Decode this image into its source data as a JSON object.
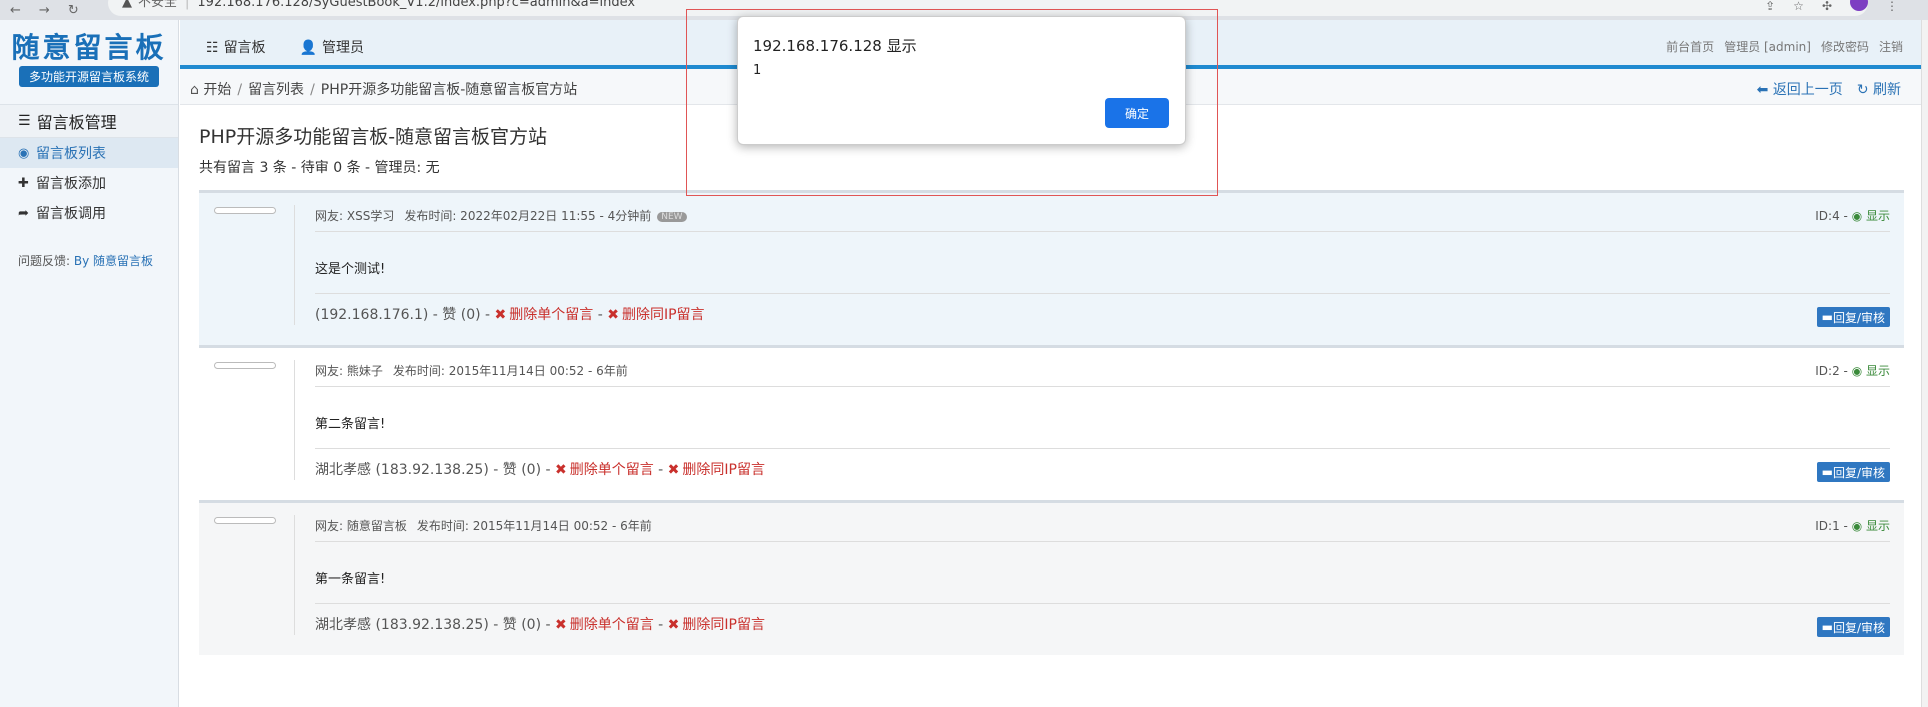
{
  "browser": {
    "insecure_label": "不安全",
    "url": "192.168.176.128/SyGuestBook_V1.2/index.php?c=admin&a=index"
  },
  "sidebar": {
    "logo_title": "随意留言板",
    "logo_sub": "多功能开源留言板系统",
    "section_title": "留言板管理",
    "items": [
      {
        "label": "留言板列表",
        "icon": "globe-icon",
        "active": true
      },
      {
        "label": "留言板添加",
        "icon": "plus-icon",
        "active": false
      },
      {
        "label": "留言板调用",
        "icon": "share-icon",
        "active": false
      }
    ],
    "feedback_label": "问题反馈:",
    "feedback_link": "By 随意留言板"
  },
  "topnav": {
    "tab_guestbook": "留言板",
    "tab_admin": "管理员",
    "link_front": "前台首页",
    "link_admin": "管理员 [admin]",
    "link_password": "修改密码",
    "link_logout": "注销"
  },
  "breadcrumb": {
    "home": "开始",
    "list": "留言列表",
    "site": "PHP开源多功能留言板-随意留言板官方站",
    "back": "返回上一页",
    "refresh": "刷新"
  },
  "main": {
    "title": "PHP开源多功能留言板-随意留言板官方站",
    "summary": "共有留言 3 条 - 待审 0 条 - 管理员: 无"
  },
  "messages": [
    {
      "meta": "网友: XSS学习",
      "time": "发布时间: 2022年02月22日 11:55 - 4分钟前",
      "badge": "NEW",
      "id": "ID:4 - ",
      "show": "显示",
      "content": "这是个测试!",
      "location": "(192.168.176.1) - 赞 (0) - ",
      "delete_one": "删除单个留言",
      "dash": " - ",
      "delete_ip": "删除同IP留言",
      "reply": "回复/审核"
    },
    {
      "meta": "网友: 熊妹子",
      "time": "发布时间: 2015年11月14日 00:52 - 6年前",
      "badge": "",
      "id": "ID:2 - ",
      "show": "显示",
      "content": "第二条留言!",
      "location": "湖北孝感 (183.92.138.25) - 赞 (0) - ",
      "delete_one": "删除单个留言",
      "dash": " - ",
      "delete_ip": "删除同IP留言",
      "reply": "回复/审核"
    },
    {
      "meta": "网友: 随意留言板",
      "time": "发布时间: 2015年11月14日 00:52 - 6年前",
      "badge": "",
      "id": "ID:1 - ",
      "show": "显示",
      "content": "第一条留言!",
      "location": "湖北孝感 (183.92.138.25) - 赞 (0) - ",
      "delete_one": "删除单个留言",
      "dash": " - ",
      "delete_ip": "删除同IP留言",
      "reply": "回复/审核"
    }
  ],
  "dialog": {
    "title": "192.168.176.128 显示",
    "message": "1",
    "ok": "确定"
  },
  "colors": {
    "accent": "#1f8ad0",
    "link": "#2a72b5",
    "danger": "#c9302c",
    "dialog_button": "#1a73e8"
  }
}
